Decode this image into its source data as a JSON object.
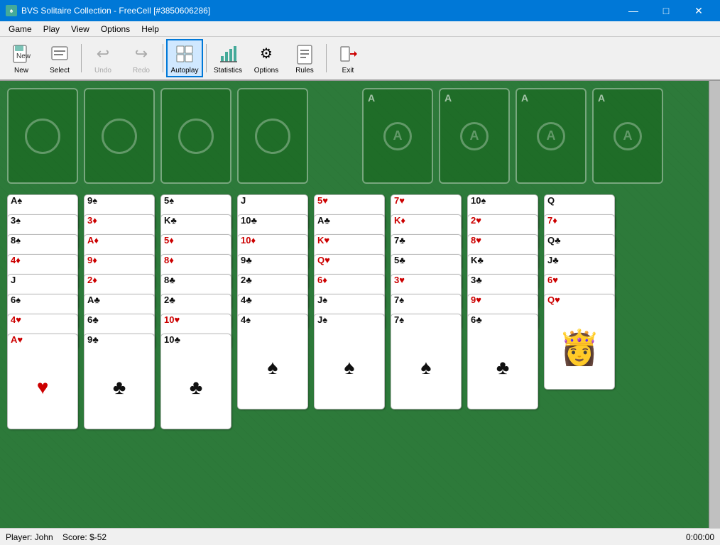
{
  "window": {
    "title": "BVS Solitaire Collection - FreeCell [#3850606286]",
    "icon": "♠"
  },
  "title_controls": {
    "minimize": "—",
    "maximize": "□",
    "close": "✕"
  },
  "menu": {
    "items": [
      "Game",
      "Play",
      "View",
      "Options",
      "Help"
    ]
  },
  "toolbar": {
    "buttons": [
      {
        "id": "new",
        "label": "New",
        "icon": "🃏",
        "active": false,
        "disabled": false
      },
      {
        "id": "select",
        "label": "Select",
        "icon": "📋",
        "active": false,
        "disabled": false
      },
      {
        "id": "undo",
        "label": "Undo",
        "icon": "↩",
        "active": false,
        "disabled": true
      },
      {
        "id": "redo",
        "label": "Redo",
        "icon": "↪",
        "active": false,
        "disabled": true
      },
      {
        "id": "autoplay",
        "label": "Autoplay",
        "icon": "▶",
        "active": true,
        "disabled": false
      },
      {
        "id": "statistics",
        "label": "Statistics",
        "icon": "📊",
        "active": false,
        "disabled": false
      },
      {
        "id": "options",
        "label": "Options",
        "icon": "⚙",
        "active": false,
        "disabled": false
      },
      {
        "id": "rules",
        "label": "Rules",
        "icon": "📖",
        "active": false,
        "disabled": false
      },
      {
        "id": "exit",
        "label": "Exit",
        "icon": "🚪",
        "active": false,
        "disabled": false
      }
    ]
  },
  "freecells": [
    {
      "id": "fc1",
      "card": null
    },
    {
      "id": "fc2",
      "card": null
    },
    {
      "id": "fc3",
      "card": null
    },
    {
      "id": "fc4",
      "card": null
    }
  ],
  "foundations": [
    {
      "id": "f1",
      "label": "A",
      "suit": "♠",
      "color": "black"
    },
    {
      "id": "f2",
      "label": "A",
      "suit": "♠",
      "color": "black"
    },
    {
      "id": "f3",
      "label": "A",
      "suit": "♠",
      "color": "black"
    },
    {
      "id": "f4",
      "label": "A",
      "suit": "♠",
      "color": "black"
    }
  ],
  "tableau": {
    "columns": [
      {
        "id": "col1",
        "cards": [
          {
            "rank": "A",
            "suit": "♠",
            "color": "black"
          },
          {
            "rank": "3",
            "suit": "♠",
            "color": "black"
          },
          {
            "rank": "8",
            "suit": "♠",
            "color": "black"
          },
          {
            "rank": "4",
            "suit": "♦",
            "color": "red"
          },
          {
            "rank": "J",
            "suit": "👑",
            "color": "black",
            "face": true
          },
          {
            "rank": "6",
            "suit": "♠",
            "color": "black"
          },
          {
            "rank": "4",
            "suit": "♥",
            "color": "red"
          },
          {
            "rank": "A",
            "suit": "♥",
            "color": "red"
          }
        ]
      },
      {
        "id": "col2",
        "cards": [
          {
            "rank": "9",
            "suit": "♠",
            "color": "black"
          },
          {
            "rank": "3",
            "suit": "♦",
            "color": "red"
          },
          {
            "rank": "A",
            "suit": "♦",
            "color": "red"
          },
          {
            "rank": "9",
            "suit": "♦",
            "color": "red"
          },
          {
            "rank": "2",
            "suit": "♦",
            "color": "red"
          },
          {
            "rank": "A",
            "suit": "♣",
            "color": "black"
          },
          {
            "rank": "6",
            "suit": "♣",
            "color": "black"
          },
          {
            "rank": "9",
            "suit": "♣",
            "color": "black"
          }
        ]
      },
      {
        "id": "col3",
        "cards": [
          {
            "rank": "5",
            "suit": "♠",
            "color": "black"
          },
          {
            "rank": "K",
            "suit": "♣",
            "color": "black",
            "face": true
          },
          {
            "rank": "5",
            "suit": "♦",
            "color": "red"
          },
          {
            "rank": "8",
            "suit": "♦",
            "color": "red"
          },
          {
            "rank": "8",
            "suit": "♣",
            "color": "black"
          },
          {
            "rank": "2",
            "suit": "♣",
            "color": "black"
          },
          {
            "rank": "10",
            "suit": "♥",
            "color": "red"
          },
          {
            "rank": "10",
            "suit": "♣",
            "color": "black"
          }
        ]
      },
      {
        "id": "col4",
        "cards": [
          {
            "rank": "J",
            "suit": "👑",
            "color": "black",
            "face": true
          },
          {
            "rank": "10",
            "suit": "♣",
            "color": "black"
          },
          {
            "rank": "10",
            "suit": "♦",
            "color": "red"
          },
          {
            "rank": "9",
            "suit": "♣",
            "color": "black"
          },
          {
            "rank": "2",
            "suit": "♣",
            "color": "black"
          },
          {
            "rank": "4",
            "suit": "♣",
            "color": "black"
          },
          {
            "rank": "4",
            "suit": "♠",
            "color": "black"
          }
        ]
      },
      {
        "id": "col5",
        "cards": [
          {
            "rank": "5",
            "suit": "♥",
            "color": "red"
          },
          {
            "rank": "A",
            "suit": "♣",
            "color": "black"
          },
          {
            "rank": "K",
            "suit": "♥",
            "color": "red",
            "face": true
          },
          {
            "rank": "Q",
            "suit": "♥",
            "color": "red",
            "face": true
          },
          {
            "rank": "6",
            "suit": "♦",
            "color": "red"
          },
          {
            "rank": "J",
            "suit": "♠",
            "color": "black",
            "face": true
          },
          {
            "rank": "J",
            "suit": "♠",
            "color": "black"
          }
        ]
      },
      {
        "id": "col6",
        "cards": [
          {
            "rank": "7",
            "suit": "♥",
            "color": "red"
          },
          {
            "rank": "K",
            "suit": "♦",
            "color": "red",
            "face": true
          },
          {
            "rank": "7",
            "suit": "♣",
            "color": "black"
          },
          {
            "rank": "5",
            "suit": "♣",
            "color": "black"
          },
          {
            "rank": "3",
            "suit": "♥",
            "color": "red"
          },
          {
            "rank": "7",
            "suit": "♠",
            "color": "black"
          },
          {
            "rank": "7",
            "suit": "♠",
            "color": "black"
          }
        ]
      },
      {
        "id": "col7",
        "cards": [
          {
            "rank": "10",
            "suit": "♠",
            "color": "black"
          },
          {
            "rank": "2",
            "suit": "♥",
            "color": "red"
          },
          {
            "rank": "8",
            "suit": "♥",
            "color": "red"
          },
          {
            "rank": "K",
            "suit": "♣",
            "color": "black",
            "face": true
          },
          {
            "rank": "3",
            "suit": "♣",
            "color": "black"
          },
          {
            "rank": "9",
            "suit": "♥",
            "color": "red"
          },
          {
            "rank": "6",
            "suit": "♣",
            "color": "black"
          }
        ]
      },
      {
        "id": "col8",
        "cards": [
          {
            "rank": "Q",
            "suit": "👑",
            "color": "black",
            "face": true
          },
          {
            "rank": "7",
            "suit": "♦",
            "color": "red"
          },
          {
            "rank": "Q",
            "suit": "♣",
            "color": "black"
          },
          {
            "rank": "J",
            "suit": "♣",
            "color": "black"
          },
          {
            "rank": "6",
            "suit": "♥",
            "color": "red"
          },
          {
            "rank": "Q",
            "suit": "♥",
            "color": "red",
            "face": true
          }
        ]
      }
    ]
  },
  "status": {
    "player": "Player: John",
    "score": "Score: $-52",
    "time": "0:00:00"
  }
}
